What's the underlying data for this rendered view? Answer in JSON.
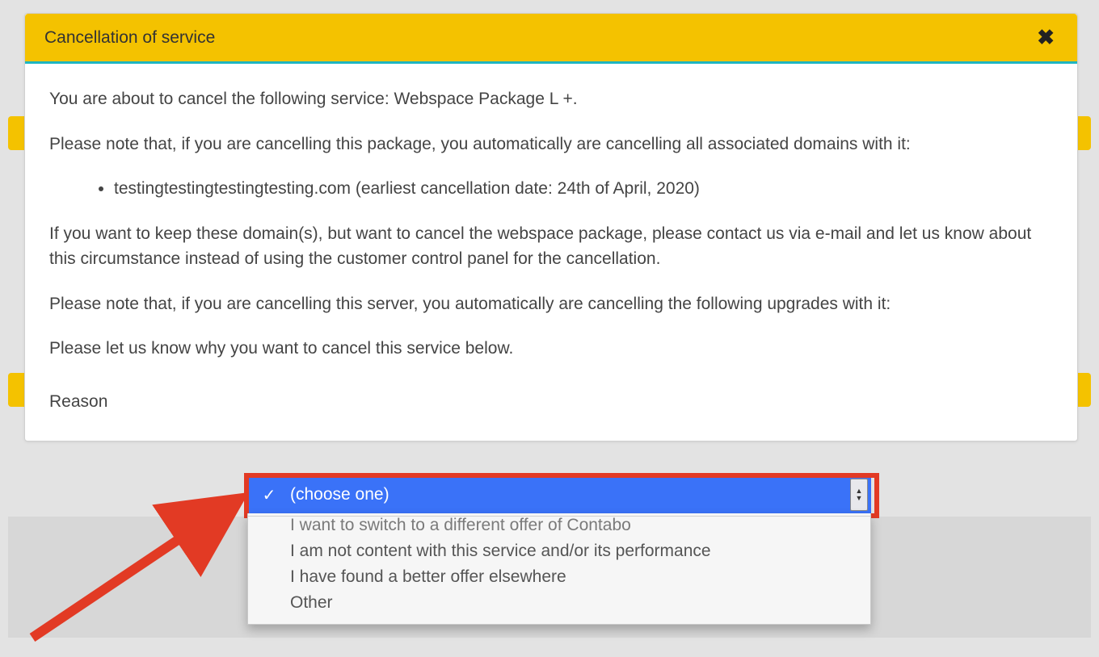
{
  "dialog": {
    "title": "Cancellation of service",
    "close_label": "Close",
    "intro": "You are about to cancel the following service: Webspace Package L +.",
    "domains_note": "Please note that, if you are cancelling this package, you automatically are cancelling all associated domains with it:",
    "domain_item": "testingtestingtestingtesting.com (earliest cancellation date: 24th of April, 2020)",
    "keep_domains_note": "If you want to keep these domain(s), but want to cancel the webspace package, please contact us via e-mail and let us know about this circumstance instead of using the customer control panel for the cancellation.",
    "upgrades_note": "Please note that, if you are cancelling this server, you automatically are cancelling the following upgrades with it:",
    "reason_prompt": "Please let us know why you want to cancel this service below.",
    "reason_label": "Reason"
  },
  "reason_select": {
    "selected": "(choose one)",
    "options": [
      "I want to switch to a different offer of Contabo",
      "I am not content with this service and/or its performance",
      "I have found a better offer elsewhere",
      "Other"
    ]
  }
}
